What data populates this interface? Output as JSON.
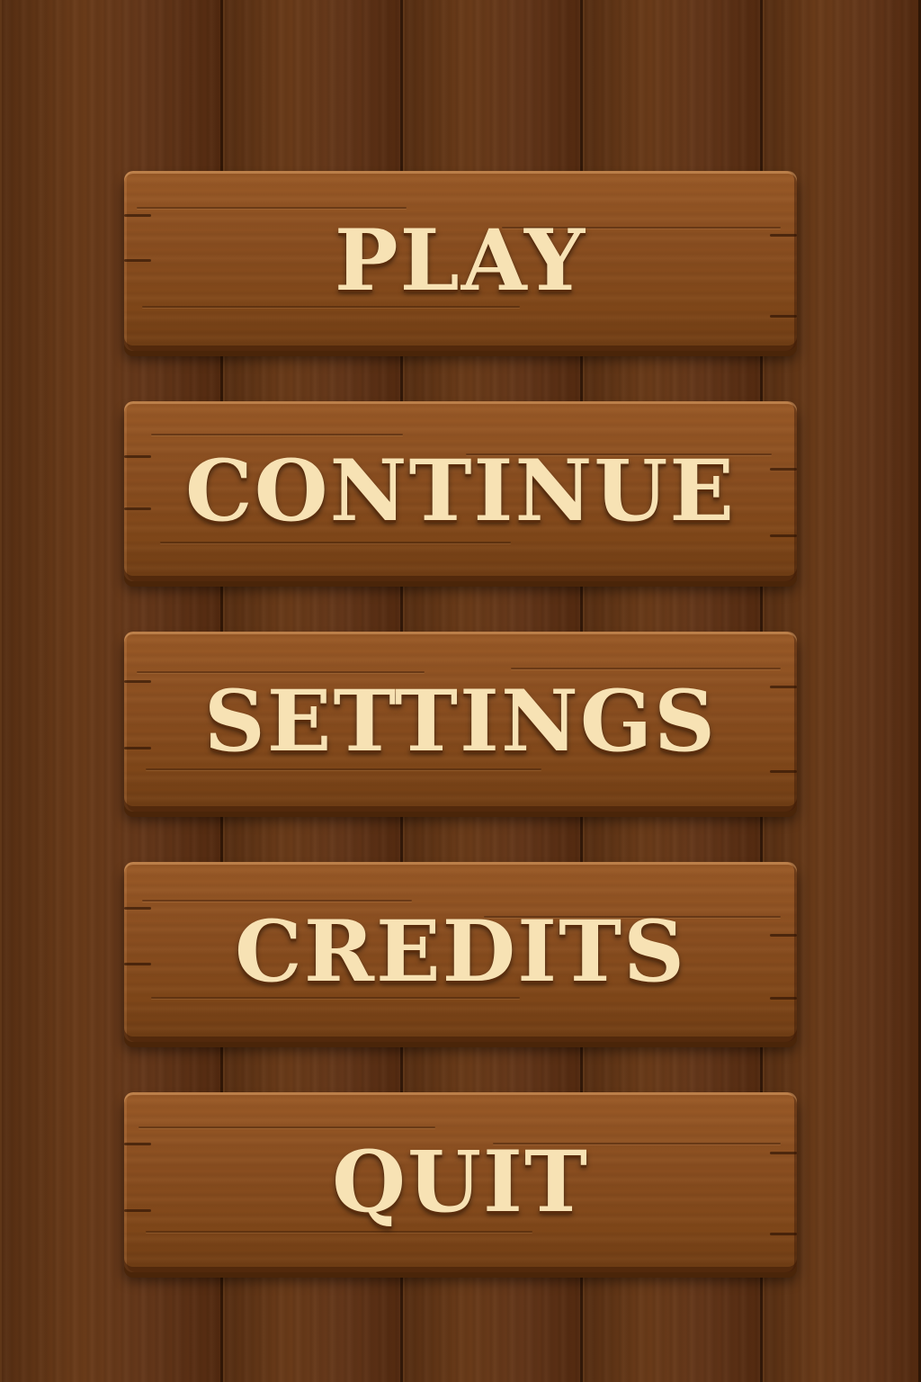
{
  "menu": {
    "items": [
      {
        "label": "PLAY"
      },
      {
        "label": "CONTINUE"
      },
      {
        "label": "SETTINGS"
      },
      {
        "label": "CREDITS"
      },
      {
        "label": "QUIT"
      }
    ]
  },
  "colors": {
    "background_wood": "#5e3416",
    "board_wood": "#8a4e20",
    "label_text": "#f7e2b4"
  }
}
